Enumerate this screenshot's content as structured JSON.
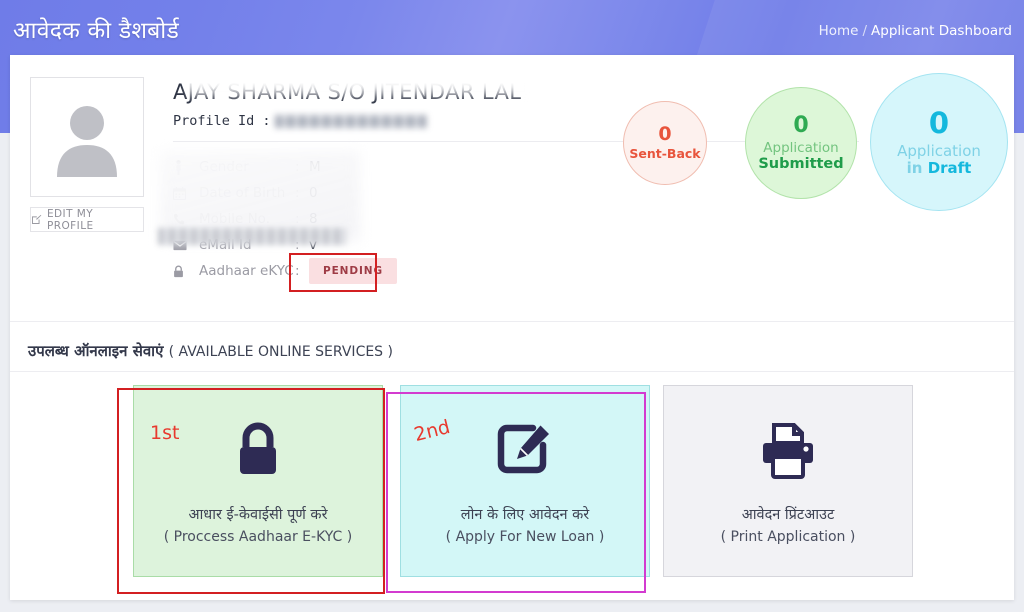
{
  "header": {
    "title": "आवेदक की डैशबोर्ड",
    "breadcrumb": {
      "home": "Home",
      "separator": "/",
      "current": "Applicant Dashboard"
    }
  },
  "profile": {
    "avatar_icon": "user-avatar-icon",
    "edit_button_label": "EDIT MY PROFILE",
    "edit_button_icon": "pencil-square-icon",
    "person_name": "AJAY SHARMA S/O JITENDAR LAL",
    "profile_id_label": "Profile Id :",
    "profile_id_value": "",
    "details": [
      {
        "icon": "person-icon",
        "label": "Gender",
        "colon": ":",
        "value": "M"
      },
      {
        "icon": "calendar-icon",
        "label": "Date of Birth",
        "colon": ":",
        "value": "0"
      },
      {
        "icon": "phone-icon",
        "label": "Mobile No.",
        "colon": ":",
        "value": "8"
      },
      {
        "icon": "envelope-icon",
        "label": "eMail Id",
        "colon": ":",
        "value": "v"
      },
      {
        "icon": "lock-icon",
        "label": "Aadhaar eKYC",
        "colon": ":",
        "value": ""
      }
    ],
    "ekyc_status_badge": "PENDING"
  },
  "status_circles": [
    {
      "count": "0",
      "line1": "",
      "line2": "Sent-Back",
      "color": "#e8543c",
      "bg": "#fdf1ee"
    },
    {
      "count": "0",
      "line1": "Application",
      "line2": "Submitted",
      "color": "#1f9c4a",
      "bg": "#ddf7d8"
    },
    {
      "count": "0",
      "line1": "Application",
      "line2_prefix": "in ",
      "line2": "Draft",
      "color": "#14b8dd",
      "bg": "#d6f6fb"
    }
  ],
  "services": {
    "title_hi": "उपलब्ध ऑनलाइन सेवाएं ",
    "title_en": "( AVAILABLE ONLINE SERVICES )",
    "cards": [
      {
        "icon": "lock-icon",
        "label_hi": "आधार ई-केवाईसी पूर्ण करे",
        "label_en": "( Proccess Aadhaar E-KYC )",
        "order_badge": "1st",
        "bg": "#ddf3dc",
        "border": "#a9dca7",
        "annotation_color": "#d31f21"
      },
      {
        "icon": "edit-square-icon",
        "label_hi": "लोन के लिए आवेदन करे",
        "label_en": "( Apply For New Loan )",
        "order_badge": "2nd",
        "bg": "#d3f7f7",
        "border": "#9fdfe2",
        "annotation_color": "#d33bd0"
      },
      {
        "icon": "printer-icon",
        "label_hi": "आवेदन प्रिंटआउट",
        "label_en": "( Print Application )",
        "order_badge": "",
        "bg": "#f2f2f5",
        "border": "#d6d6dc",
        "annotation_color": ""
      }
    ]
  }
}
